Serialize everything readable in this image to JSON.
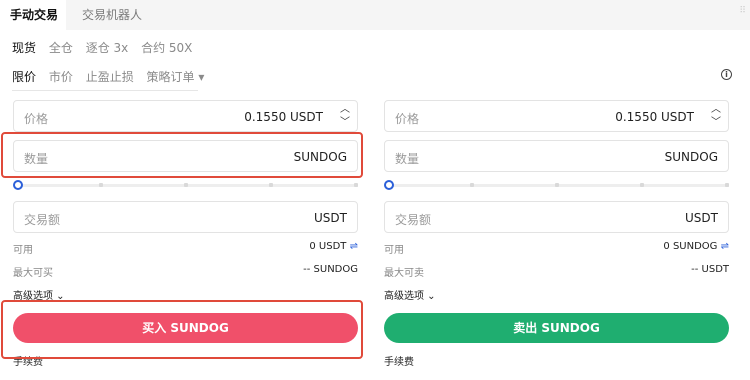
{
  "top_tabs": {
    "manual": "手动交易",
    "bot": "交易机器人"
  },
  "trade_modes": [
    "现货",
    "全仓",
    "逐仓 3x",
    "合约 50X"
  ],
  "order_types": [
    "限价",
    "市价",
    "止盈止损",
    "策略订单 ▾"
  ],
  "info_icon": "i",
  "corner_icon": "⠿",
  "spinner": {
    "up": "︿",
    "down": "﹀"
  },
  "buy": {
    "price_label": "价格",
    "price_value": "0.1550 USDT",
    "qty_label": "数量",
    "qty_unit": "SUNDOG",
    "slider_percent": 0,
    "amount_label": "交易额",
    "amount_unit": "USDT",
    "available_label": "可用",
    "available_value": "0 USDT",
    "swap_icon": "⇌",
    "max_label": "最大可买",
    "max_value": "-- SUNDOG",
    "advanced_label": "高级选项 ⌄",
    "button_label": "买入 SUNDOG",
    "fee_label": "手续费",
    "button_color": "#f0506a"
  },
  "sell": {
    "price_label": "价格",
    "price_value": "0.1550 USDT",
    "qty_label": "数量",
    "qty_unit": "SUNDOG",
    "slider_percent": 0,
    "amount_label": "交易额",
    "amount_unit": "USDT",
    "available_label": "可用",
    "available_value": "0 SUNDOG",
    "swap_icon": "⇌",
    "max_label": "最大可卖",
    "max_value": "-- USDT",
    "advanced_label": "高级选项 ⌄",
    "button_label": "卖出 SUNDOG",
    "fee_label": "手续费",
    "button_color": "#1fae70"
  },
  "highlight_color": "#e04a3a"
}
